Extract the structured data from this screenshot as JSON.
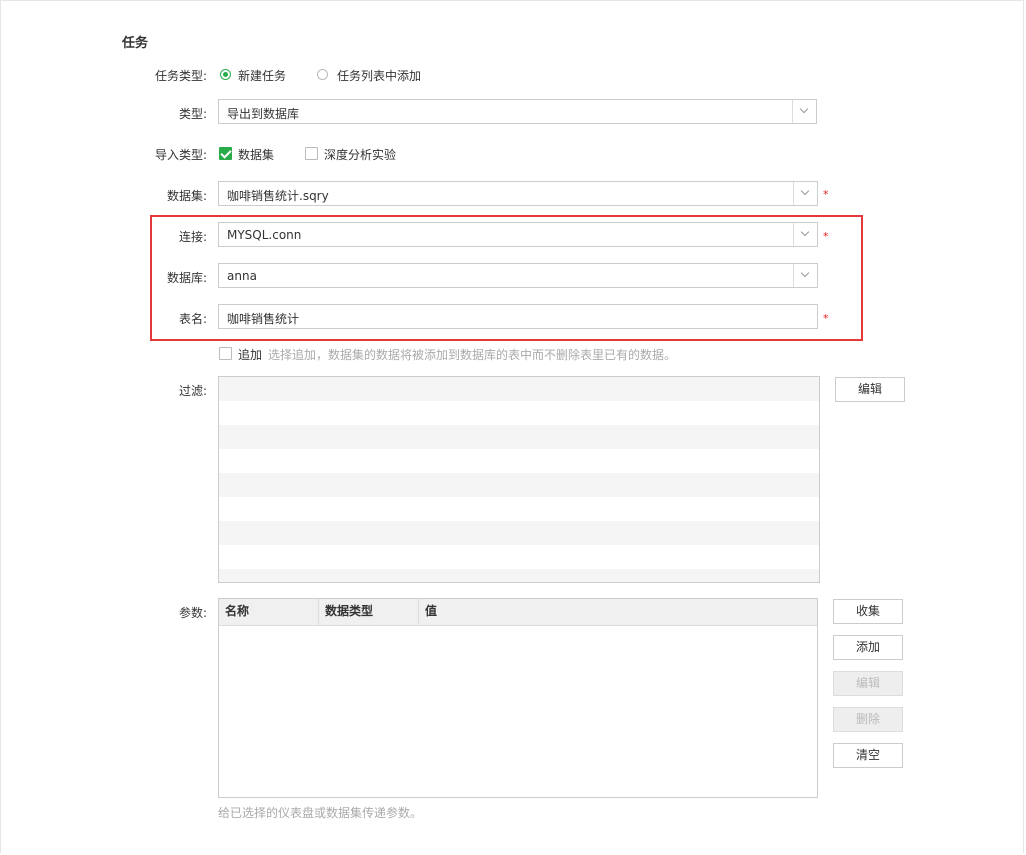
{
  "section": {
    "title": "任务"
  },
  "task_type": {
    "label": "任务类型:",
    "options": [
      {
        "label": "新建任务",
        "selected": true
      },
      {
        "label": "任务列表中添加",
        "selected": false
      }
    ]
  },
  "type": {
    "label": "类型:",
    "value": "导出到数据库"
  },
  "import_type": {
    "label": "导入类型:",
    "options": [
      {
        "label": "数据集",
        "checked": true
      },
      {
        "label": "深度分析实验",
        "checked": false
      }
    ]
  },
  "dataset": {
    "label": "数据集:",
    "value": "咖啡销售统计.sqry",
    "required": "*"
  },
  "connection": {
    "label": "连接:",
    "value": "MYSQL.conn",
    "required": "*"
  },
  "database": {
    "label": "数据库:",
    "value": "anna"
  },
  "table_name": {
    "label": "表名:",
    "value": "咖啡销售统计",
    "required": "*"
  },
  "append": {
    "label": "追加",
    "checked": false,
    "hint": "选择追加，数据集的数据将被添加到数据库的表中而不删除表里已有的数据。"
  },
  "filter": {
    "label": "过滤:",
    "edit_button": "编辑"
  },
  "params": {
    "label": "参数:",
    "columns": [
      "名称",
      "数据类型",
      "值"
    ],
    "buttons": {
      "collect": "收集",
      "add": "添加",
      "edit": "编辑",
      "delete": "删除",
      "clear": "清空"
    },
    "hint": "给已选择的仪表盘或数据集传递参数。"
  },
  "colors": {
    "accent": "#2aab4a",
    "highlight_box": "#e5383b",
    "required": "#e02020"
  }
}
